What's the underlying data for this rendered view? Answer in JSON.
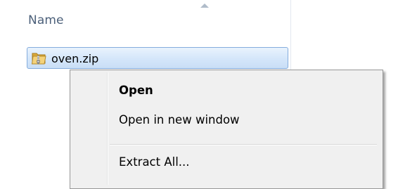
{
  "file_list": {
    "column_name_label": "Name",
    "selected_file": {
      "name": "oven.zip",
      "icon": "zip-folder-icon"
    }
  },
  "context_menu": {
    "items": [
      {
        "label": "Open",
        "bold": true
      },
      {
        "label": "Open in new window",
        "bold": false
      },
      {
        "label": "Extract All...",
        "bold": false
      }
    ]
  },
  "colors": {
    "selection_border": "#84acdd",
    "selection_fill": "#d4e6fa",
    "header_text": "#4c607a",
    "menu_background": "#f0f0f0"
  }
}
